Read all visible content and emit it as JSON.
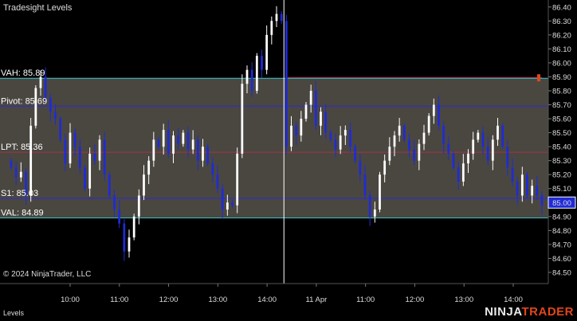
{
  "app": {
    "title": "Tradesight Levels",
    "copyright": "© 2024 NinjaTrader, LLC",
    "footer_tab": "Levels",
    "brand_part1": "NINJA",
    "brand_part2": "TRADER"
  },
  "colors": {
    "background": "#000000",
    "value_area_fill": "#4a4740",
    "up_candle": "#ffffff",
    "down_candle": "#1f2bd6",
    "vah_val_line": "#35c7cf",
    "pivot_s1_line": "#2b2bd6",
    "lpt_line": "#a3334c",
    "last_price_box": "#1f2bd6",
    "marker": "#e0461c"
  },
  "chart_data": {
    "type": "candlestick",
    "title": "Tradesight Levels",
    "ylim": [
      84.42,
      86.45
    ],
    "y_ticks": [
      "86.40",
      "86.30",
      "86.20",
      "86.10",
      "86.00",
      "85.90",
      "85.80",
      "85.70",
      "85.60",
      "85.50",
      "85.40",
      "85.30",
      "85.20",
      "85.10",
      "85.00",
      "84.90",
      "84.80",
      "84.70",
      "84.60",
      "84.50"
    ],
    "x_labels": [
      "10:00",
      "11:00",
      "12:00",
      "13:00",
      "14:00",
      "11 Apr",
      "11:00",
      "12:00",
      "13:00",
      "14:00"
    ],
    "last_price": "85.00",
    "levels": [
      {
        "name": "VAH",
        "label": "VAH: 85.89",
        "value": 85.89
      },
      {
        "name": "Pivot",
        "label": "Pivot: 85.69",
        "value": 85.69
      },
      {
        "name": "LPT",
        "label": "LPT: 85.36",
        "value": 85.36
      },
      {
        "name": "S1",
        "label": "S1: 85.03",
        "value": 85.03
      },
      {
        "name": "VAL",
        "label": "VAL: 84.89",
        "value": 84.89
      }
    ],
    "value_area": [
      84.89,
      85.89
    ],
    "session_break_index": 56,
    "closes": [
      85.25,
      85.18,
      85.22,
      85.05,
      85.55,
      85.82,
      85.9,
      85.75,
      85.65,
      85.6,
      85.45,
      85.28,
      85.5,
      85.4,
      85.25,
      85.1,
      85.35,
      85.3,
      85.45,
      85.2,
      85.05,
      84.95,
      84.85,
      84.65,
      84.75,
      84.9,
      85.05,
      85.2,
      85.3,
      85.45,
      85.4,
      85.52,
      85.35,
      85.48,
      85.42,
      85.5,
      85.38,
      85.45,
      85.3,
      85.4,
      85.28,
      85.2,
      85.1,
      84.95,
      85.0,
      84.98,
      85.35,
      85.85,
      85.95,
      85.8,
      86.05,
      85.95,
      86.2,
      86.3,
      86.35,
      86.3,
      85.4,
      85.55,
      85.48,
      85.6,
      85.7,
      85.8,
      85.55,
      85.65,
      85.5,
      85.45,
      85.38,
      85.48,
      85.52,
      85.4,
      85.3,
      85.2,
      85.05,
      84.9,
      84.95,
      85.2,
      85.3,
      85.4,
      85.48,
      85.55,
      85.45,
      85.38,
      85.3,
      85.42,
      85.5,
      85.62,
      85.7,
      85.55,
      85.42,
      85.35,
      85.25,
      85.15,
      85.28,
      85.35,
      85.45,
      85.5,
      85.4,
      85.3,
      85.45,
      85.55,
      85.4,
      85.25,
      85.15,
      85.05,
      85.2,
      85.05,
      85.12,
      85.05,
      84.98
    ]
  }
}
